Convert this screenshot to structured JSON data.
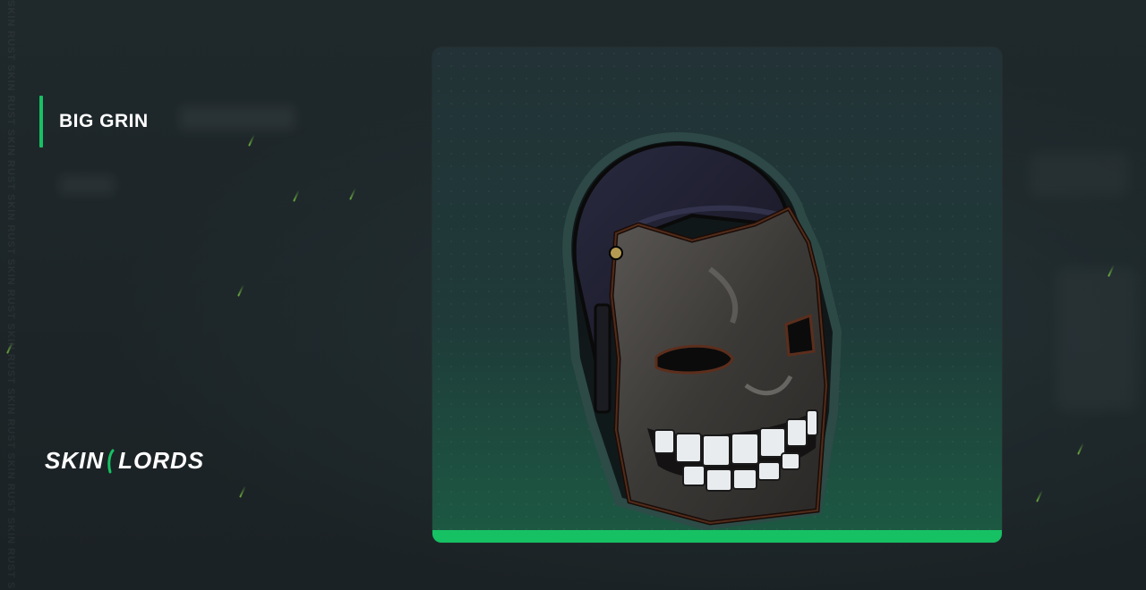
{
  "item": {
    "name": "BIG GRIN"
  },
  "brand": {
    "logo_text_left": "SKIN",
    "logo_text_right": "LORDS",
    "watermark": "SKIN RUST SKIN RUST SKIN RUST SKIN RUST SKIN RUST SKIN RUST SKIN RUST SKIN RUST SKIN RUST SKIN RUST"
  },
  "colors": {
    "accent": "#16c163",
    "background": "#1d2528",
    "card_top": "#223236",
    "card_bottom": "#1c5a43"
  },
  "icons": {
    "item_image": "big-grin-mask-icon",
    "logo_mark": "lords-slash-icon"
  }
}
